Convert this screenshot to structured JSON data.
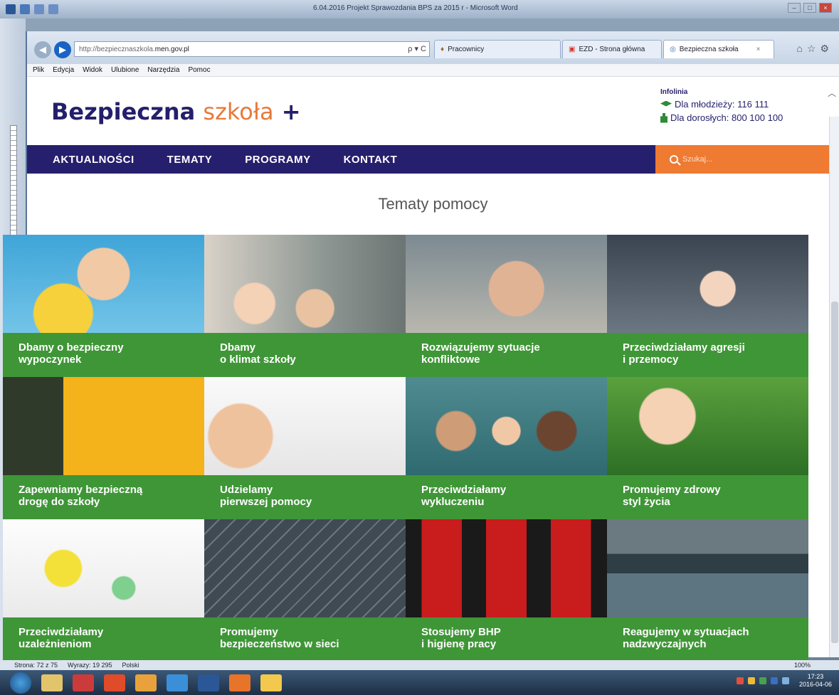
{
  "word": {
    "title": "6.04.2016 Projekt Sprawozdania BPS za 2015 r - Microsoft Word",
    "status": {
      "page": "Strona: 72 z 75",
      "words": "Wyrazy: 19 295",
      "language": "Polski",
      "zoom": "100%"
    }
  },
  "browser": {
    "address_prefix": "http://bezpiecznaszkola.",
    "address_host": "men.gov.pl",
    "address_tools": "ρ ▾ C",
    "tabs": [
      {
        "label": "Pracownicy"
      },
      {
        "label": "EZD - Strona główna"
      },
      {
        "label": "Bezpieczna szkoła",
        "active": true
      }
    ],
    "menu": [
      "Plik",
      "Edycja",
      "Widok",
      "Ulubione",
      "Narzędzia",
      "Pomoc"
    ]
  },
  "site": {
    "logo_main": "Bezpieczna",
    "logo_accent": "szkoła",
    "logo_plus": "+",
    "infoline": {
      "label": "Infolinia",
      "youth": "Dla młodzieży: 116 111",
      "adults": "Dla dorosłych: 800 100 100"
    },
    "nav": [
      "AKTUALNOŚCI",
      "TEMATY",
      "PROGRAMY",
      "KONTAKT"
    ],
    "search_placeholder": "Szukaj...",
    "section_title": "Tematy pomocy",
    "tiles": [
      {
        "line1": "Dbamy o bezpieczny",
        "line2": "wypoczynek"
      },
      {
        "line1": "Dbamy",
        "line2": "o klimat szkoły"
      },
      {
        "line1": "Rozwiązujemy sytuacje",
        "line2": "konfliktowe"
      },
      {
        "line1": "Przeciwdziałamy agresji",
        "line2": "i przemocy"
      },
      {
        "line1": "Zapewniamy bezpieczną",
        "line2": "drogę do szkoły"
      },
      {
        "line1": "Udzielamy",
        "line2": "pierwszej pomocy"
      },
      {
        "line1": "Przeciwdziałamy",
        "line2": "wykluczeniu"
      },
      {
        "line1": "Promujemy zdrowy",
        "line2": "styl życia"
      },
      {
        "line1": "Przeciwdziałamy",
        "line2": "uzależnieniom"
      },
      {
        "line1": "Promujemy",
        "line2": "bezpieczeństwo w sieci"
      },
      {
        "line1": "Stosujemy BHP",
        "line2": "i higienę pracy"
      },
      {
        "line1": "Reagujemy w sytuacjach",
        "line2": "nadzwyczajnych"
      }
    ]
  },
  "taskbar": {
    "time": "17:23",
    "date": "2016-04-06"
  },
  "colors": {
    "brand_navy": "#261f6e",
    "accent_orange": "#ef7a31",
    "tile_green": "#3f9637"
  }
}
